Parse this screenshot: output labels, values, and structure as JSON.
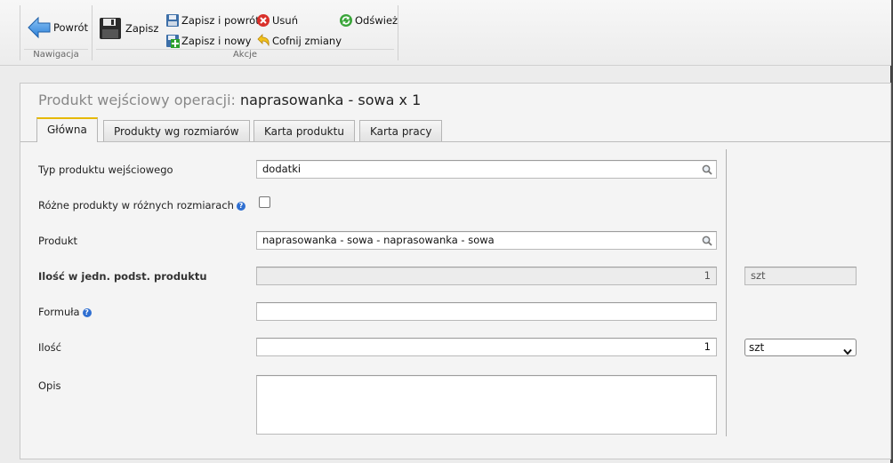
{
  "toolbar": {
    "groups": [
      {
        "label": "Nawigacja"
      },
      {
        "label": "Akcje"
      }
    ],
    "back_label": "Powrót",
    "save_label": "Zapisz",
    "save_return_label": "Zapisz i powrót",
    "save_new_label": "Zapisz i nowy",
    "delete_label": "Usuń",
    "revert_label": "Cofnij zmiany",
    "refresh_label": "Odśwież"
  },
  "panel": {
    "title_prefix": "Produkt wejściowy operacji:",
    "title_value": "naprasowanka - sowa x 1"
  },
  "tabs": [
    {
      "label": "Główna",
      "active": true
    },
    {
      "label": "Produkty wg rozmiarów",
      "active": false
    },
    {
      "label": "Karta produktu",
      "active": false
    },
    {
      "label": "Karta pracy",
      "active": false
    }
  ],
  "form": {
    "input_type_label": "Typ produktu wejściowego",
    "input_type_value": "dodatki",
    "diff_products_label": "Różne produkty w różnych rozmiarach",
    "diff_products_checked": false,
    "product_label": "Produkt",
    "product_value": "naprasowanka - sowa - naprasowanka - sowa",
    "qty_base_label": "Ilość w jedn. podst. produktu",
    "qty_base_value": "1",
    "qty_base_unit": "szt",
    "formula_label": "Formuła",
    "formula_value": "",
    "qty_label": "Ilość",
    "qty_value": "1",
    "qty_unit_selected": "szt",
    "desc_label": "Opis",
    "desc_value": ""
  },
  "colors": {
    "tab_active_accent": "#e6b800",
    "help_icon": "#2f6fd1",
    "delete_icon": "#d9302a",
    "refresh_icon": "#3aa53a",
    "back_arrow": "#3c8fe0"
  }
}
